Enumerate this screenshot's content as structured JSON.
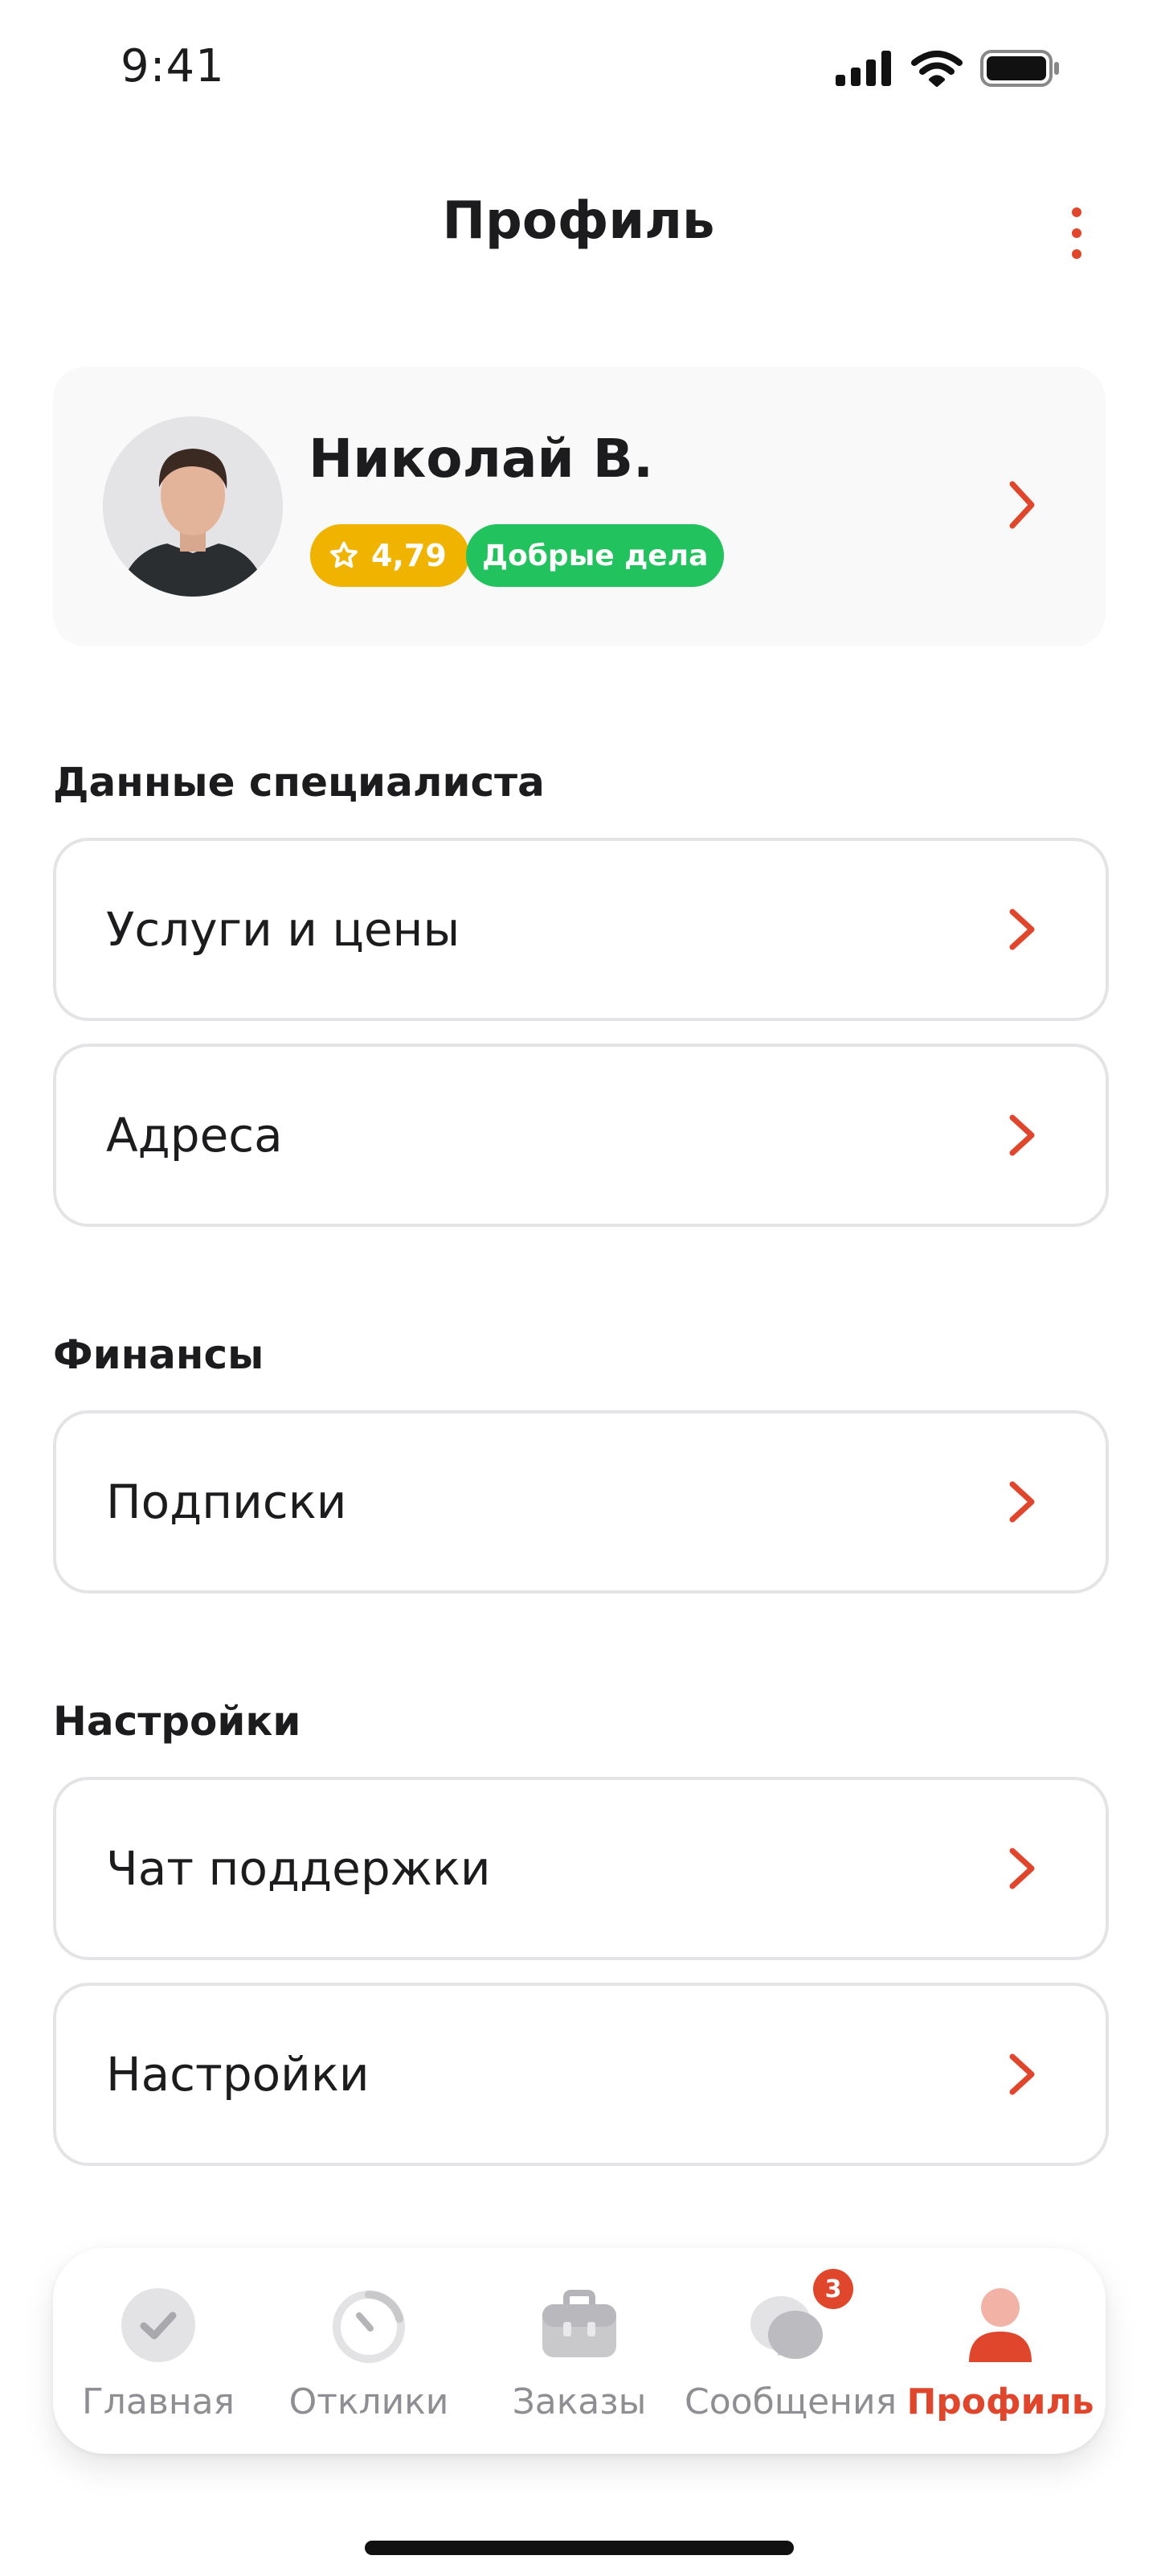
{
  "status_bar": {
    "time": "9:41"
  },
  "header": {
    "title": "Профиль",
    "more_icon": "more-vertical-icon"
  },
  "profile": {
    "name": "Николай В.",
    "rating": "4,79",
    "badge": "Добрые дела",
    "colors": {
      "rating_bg": "#f0b400",
      "badge_bg": "#22c35e"
    }
  },
  "sections": {
    "specialist": {
      "title": "Данные специалиста",
      "items": [
        "Услуги и цены",
        "Адреса"
      ]
    },
    "finance": {
      "title": "Финансы",
      "items": [
        "Подписки"
      ]
    },
    "settings": {
      "title": "Настройки",
      "items": [
        "Чат поддержки",
        "Настройки"
      ]
    }
  },
  "tabbar": {
    "tabs": [
      {
        "label": "Главная",
        "icon": "check-circle-icon"
      },
      {
        "label": "Отклики",
        "icon": "timer-icon"
      },
      {
        "label": "Заказы",
        "icon": "briefcase-icon"
      },
      {
        "label": "Сообщения",
        "icon": "chat-icon",
        "badge": "3"
      },
      {
        "label": "Профиль",
        "icon": "user-icon",
        "active": true
      }
    ]
  },
  "colors": {
    "accent": "#e0462b",
    "inactive": "#8e8e93"
  }
}
